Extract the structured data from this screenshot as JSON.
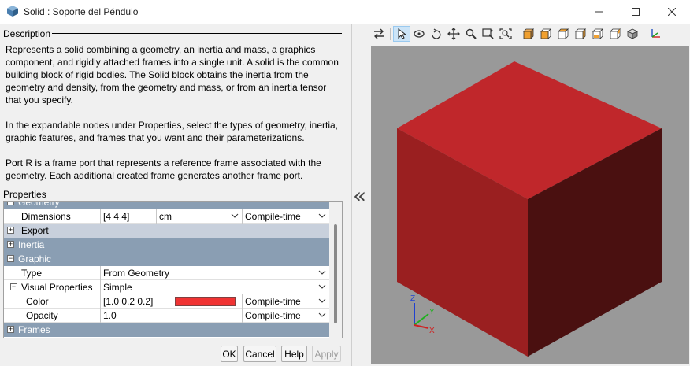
{
  "window": {
    "title": "Solid : Soporte del Péndulo",
    "icon": "cube-icon",
    "controls": [
      "minimize-icon",
      "maximize-icon",
      "close-icon"
    ]
  },
  "description": {
    "heading": "Description",
    "paragraphs": [
      "Represents a solid combining a geometry, an inertia and mass, a graphics component, and rigidly attached frames into a single unit. A solid is the common building block of rigid bodies. The Solid block obtains the inertia from the geometry and density, from the geometry and mass, or from an inertia tensor that you specify.",
      "In the expandable nodes under Properties, select the types of geometry, inertia, graphic features, and frames that you want and their parameterizations.",
      "Port R is a frame port that represents a reference frame associated with the geometry. Each additional created frame generates another frame port."
    ]
  },
  "properties": {
    "heading": "Properties",
    "geometry_group": "Geometry",
    "dimensions": {
      "label": "Dimensions",
      "value": "[4 4 4]",
      "unit": "cm",
      "mode": "Compile-time"
    },
    "export": "Export",
    "inertia": "Inertia",
    "graphic": "Graphic",
    "type": {
      "label": "Type",
      "value": "From Geometry"
    },
    "visual_properties": {
      "label": "Visual Properties",
      "value": "Simple"
    },
    "color": {
      "label": "Color",
      "value": "[1.0 0.2 0.2]",
      "swatch": "#f03333",
      "mode": "Compile-time"
    },
    "opacity": {
      "label": "Opacity",
      "value": "1.0",
      "mode": "Compile-time"
    },
    "frames": "Frames"
  },
  "buttons": {
    "ok": "OK",
    "cancel": "Cancel",
    "help": "Help",
    "apply": "Apply"
  },
  "splitter": {
    "collapse_glyph": "«"
  },
  "toolbar_icons": [
    "swap-icon",
    "select-pointer-icon",
    "rotate-icon",
    "roll-icon",
    "pan-icon",
    "zoom-icon",
    "zoom-box-icon",
    "fit-view-icon",
    "view-front-icon",
    "view-back-icon",
    "view-left-icon",
    "view-right-icon",
    "view-top-icon",
    "view-bottom-icon",
    "view-isometric-icon",
    "axes-triad-icon"
  ],
  "viewport": {
    "background": "#999999",
    "cube_colors": {
      "top": "#c0272b",
      "left": "#9a1f20",
      "right": "#4a1010"
    },
    "triad_labels": {
      "x": "X",
      "y": "Y",
      "z": "Z"
    }
  }
}
